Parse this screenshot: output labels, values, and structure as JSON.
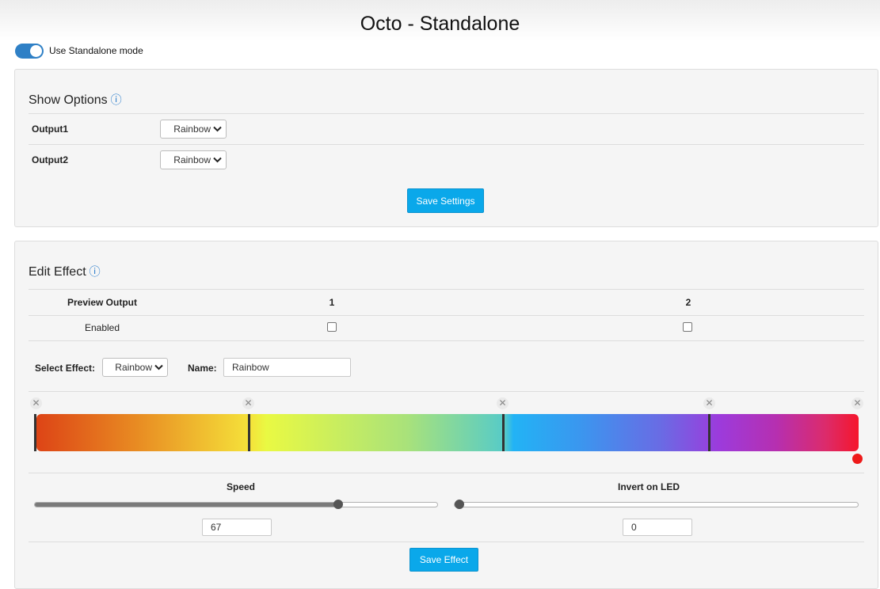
{
  "title": "Octo - Standalone",
  "standalone": {
    "label": "Use Standalone mode",
    "enabled": true
  },
  "show_options": {
    "heading": "Show Options",
    "outputs": [
      {
        "label": "Output1",
        "value": "Rainbow"
      },
      {
        "label": "Output2",
        "value": "Rainbow"
      }
    ],
    "save_label": "Save Settings"
  },
  "edit_effect": {
    "heading": "Edit Effect",
    "preview_label": "Preview Output",
    "columns": [
      "1",
      "2"
    ],
    "enabled_label": "Enabled",
    "enabled_values": [
      false,
      false
    ],
    "select_effect_label": "Select Effect:",
    "select_effect_value": "Rainbow",
    "name_label": "Name:",
    "name_value": "Rainbow",
    "gradient_colors": [
      "#dd4416",
      "#f5e23a",
      "#e9f943",
      "#22b3f5",
      "#9c3bdc",
      "#f5162c"
    ],
    "selected_stop_color": "#ee1a1a",
    "speed_label": "Speed",
    "speed_value": "67",
    "speed_fraction": 0.76,
    "invert_label": "Invert on LED",
    "invert_value": "0",
    "invert_fraction": 0.0,
    "save_label": "Save Effect"
  }
}
